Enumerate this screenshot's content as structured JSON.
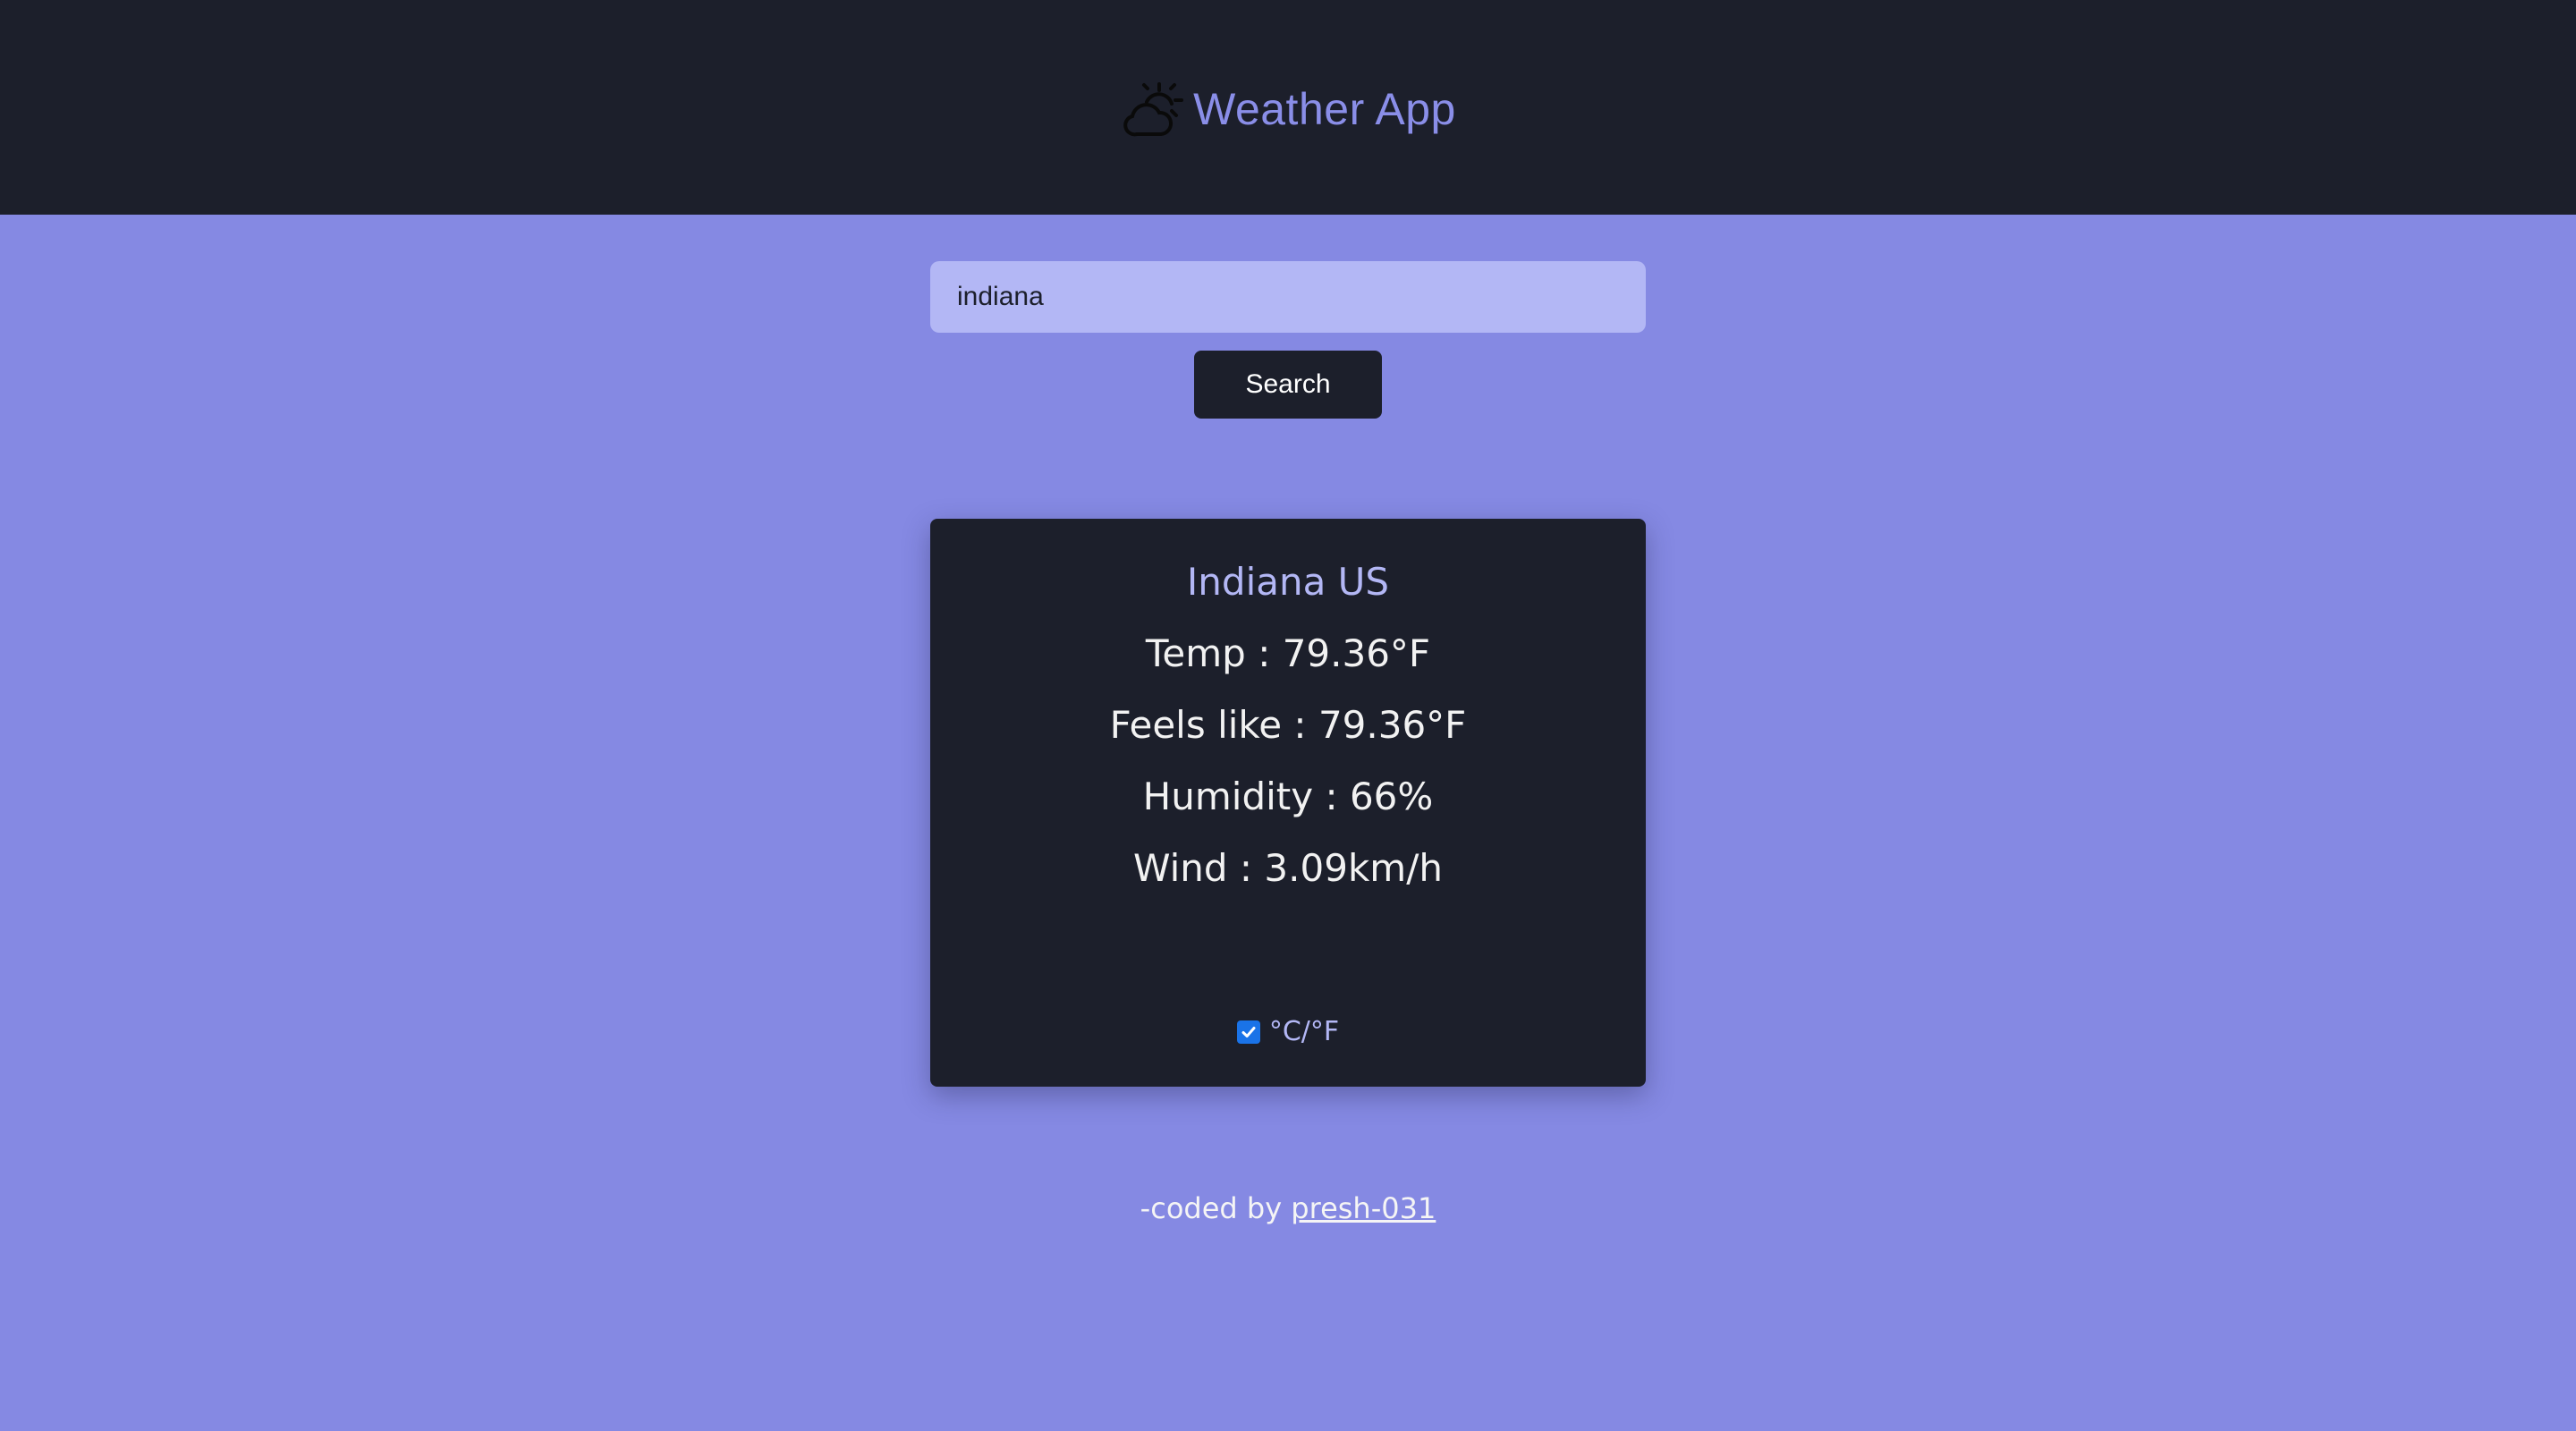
{
  "header": {
    "title": "Weather App",
    "icon": "cloud-sun-icon",
    "background": "#1c1f2b",
    "title_color": "#8a8ee8"
  },
  "search": {
    "value": "indiana",
    "button_label": "Search"
  },
  "weather": {
    "city": "Indiana US",
    "temp": "Temp : 79.36°F",
    "feels_like": "Feels like : 79.36°F",
    "humidity": "Humidity : 66%",
    "wind": "Wind : 3.09km/h"
  },
  "unit_toggle": {
    "label": "°C/°F",
    "checked": true
  },
  "footer": {
    "prefix": "-coded by ",
    "author": "presh-031"
  },
  "colors": {
    "page_background": "#8589e3",
    "card_background": "#1c1f2b",
    "input_background": "#b3b7f5",
    "accent": "#8a8ee8",
    "checkbox": "#1a73e8"
  }
}
